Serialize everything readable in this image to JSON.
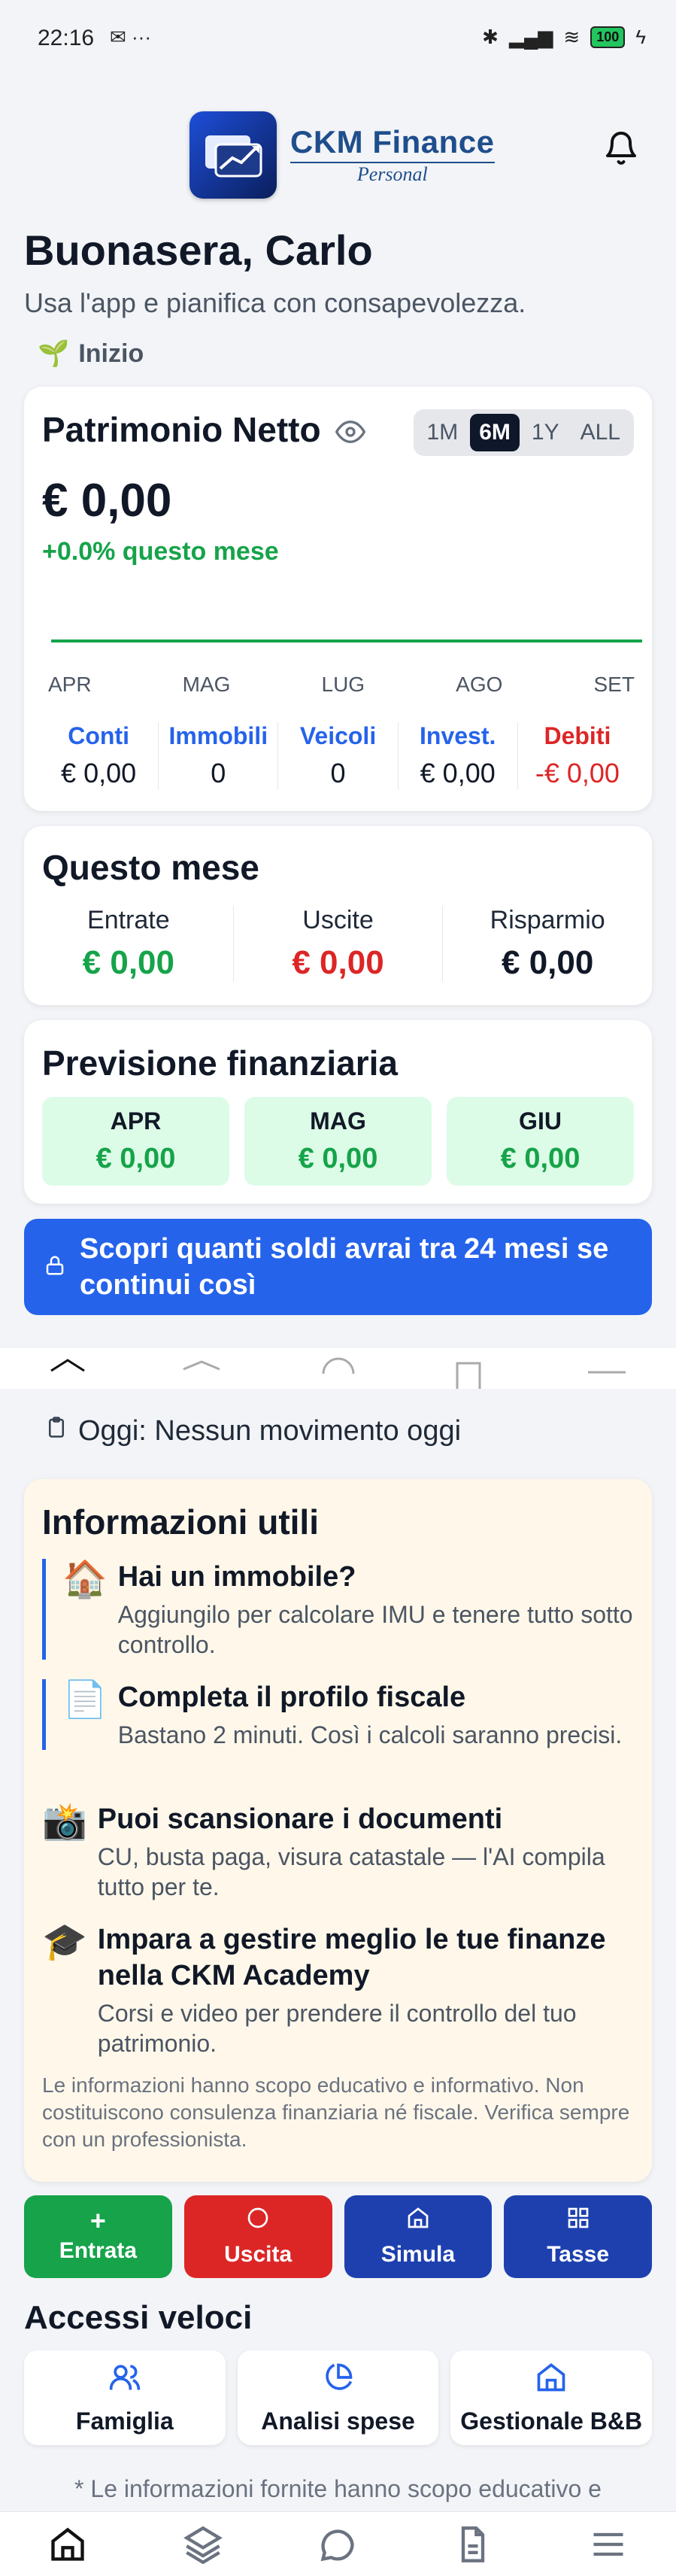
{
  "status_bar": {
    "time": "22:16",
    "battery": "100"
  },
  "header": {
    "brand": "CKM Finance",
    "brand_sub": "Personal"
  },
  "greeting": "Buonasera, Carlo",
  "subtitle": "Usa l'app e pianifica con consapevolezza.",
  "stage": {
    "icon": "seedling-icon",
    "label": "Inizio"
  },
  "net_worth": {
    "title": "Patrimonio Netto",
    "ranges": [
      "1M",
      "6M",
      "1Y",
      "ALL"
    ],
    "active_range": "6M",
    "value": "€ 0,00",
    "change": "+0.0% questo mese",
    "months": [
      "APR",
      "MAG",
      "LUG",
      "AGO",
      "SET"
    ],
    "categories": [
      {
        "label": "Conti",
        "value": "€ 0,00"
      },
      {
        "label": "Immobili",
        "value": "0"
      },
      {
        "label": "Veicoli",
        "value": "0"
      },
      {
        "label": "Invest.",
        "value": "€ 0,00"
      },
      {
        "label": "Debiti",
        "value": "-€ 0,00"
      }
    ],
    "line_color": "#16a34a"
  },
  "this_month": {
    "title": "Questo mese",
    "income_label": "Entrate",
    "income_value": "€ 0,00",
    "expense_label": "Uscite",
    "expense_value": "€ 0,00",
    "savings_label": "Risparmio",
    "savings_value": "€ 0,00"
  },
  "forecast": {
    "title": "Previsione finanziaria",
    "months": [
      {
        "label": "APR",
        "value": "€ 0,00"
      },
      {
        "label": "MAG",
        "value": "€ 0,00"
      },
      {
        "label": "GIU",
        "value": "€ 0,00"
      }
    ]
  },
  "cta": "Scopri quanti soldi avrai tra 24 mesi se continui così",
  "today": "Oggi: Nessun movimento oggi",
  "info": {
    "title": "Informazioni utili",
    "tips": [
      {
        "icon": "house-icon",
        "glyph": "🏠",
        "title": "Hai un immobile?",
        "text": "Aggiungilo per calcolare IMU e tenere tutto sotto controllo."
      },
      {
        "icon": "document-icon",
        "glyph": "📄",
        "title": "Completa il profilo fiscale",
        "text": "Bastano 2 minuti. Così i calcoli saranno precisi."
      },
      {
        "icon": "camera-icon",
        "glyph": "📸",
        "title": "Puoi scansionare i documenti",
        "text": "CU, busta paga, visura catastale — l'AI compila tutto per te."
      },
      {
        "icon": "graduation-cap-icon",
        "glyph": "🎓",
        "title": "Impara a gestire meglio le tue finanze nella CKM Academy",
        "text": "Corsi e video per prendere il controllo del tuo patrimonio."
      }
    ],
    "disclaimer": "Le informazioni hanno scopo educativo e informativo. Non costituiscono consulenza finanziaria né fiscale. Verifica sempre con un professionista."
  },
  "actions": [
    {
      "label": "Entrata",
      "icon": "plus-icon"
    },
    {
      "label": "Uscita",
      "icon": "circle-icon"
    },
    {
      "label": "Simula",
      "icon": "home-icon"
    },
    {
      "label": "Tasse",
      "icon": "grid-icon"
    }
  ],
  "quick_access": {
    "title": "Accessi veloci",
    "items": [
      {
        "label": "Famiglia",
        "icon": "users-icon"
      },
      {
        "label": "Analisi spese",
        "icon": "pie-chart-icon"
      },
      {
        "label": "Gestionale B&B",
        "icon": "home-icon"
      }
    ]
  },
  "footnote": "* Le informazioni fornite hanno scopo educativo e",
  "bottom_nav": [
    "home-icon",
    "layers-icon",
    "chat-icon",
    "document-icon",
    "menu-icon"
  ]
}
